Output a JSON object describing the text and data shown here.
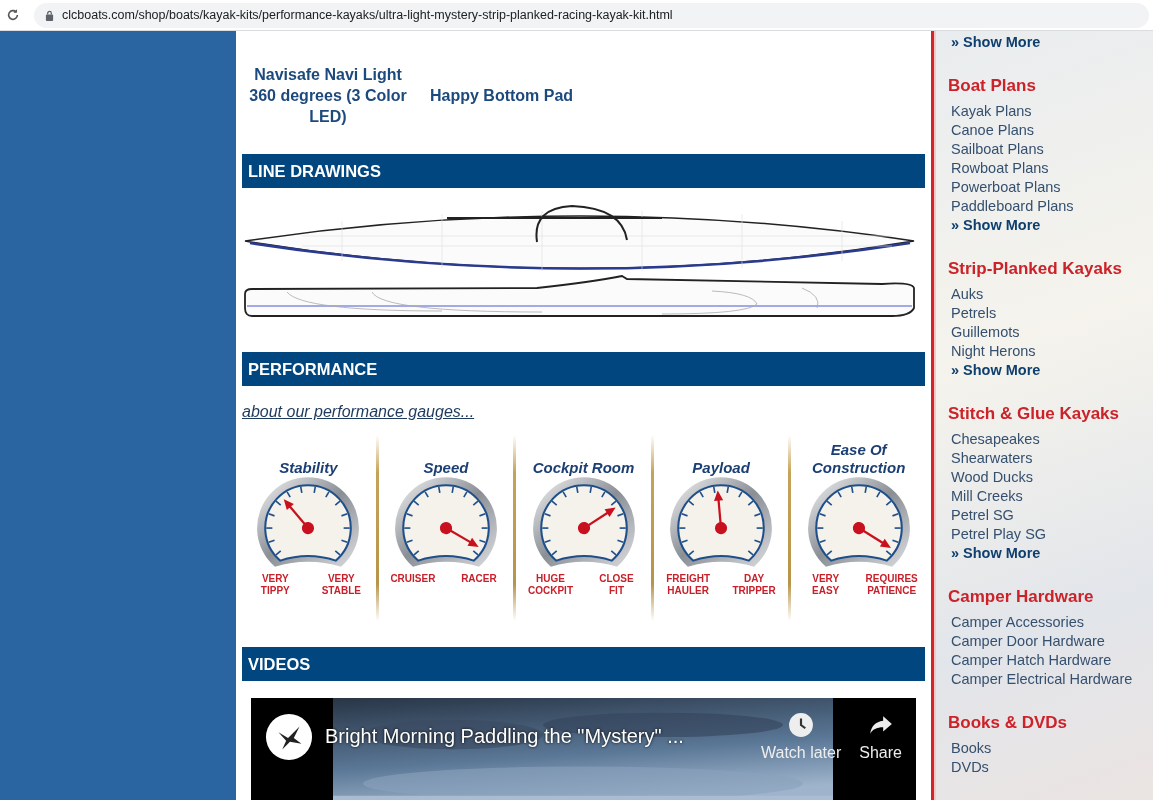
{
  "browser": {
    "url": "clcboats.com/shop/boats/kayak-kits/performance-kayaks/ultra-light-mystery-strip-planked-racing-kayak-kit.html"
  },
  "related_products": [
    {
      "name": "Navisafe Navi Light 360 degrees (3 Color LED)"
    },
    {
      "name": "Happy Bottom Pad"
    }
  ],
  "line_drawings": {
    "heading": "LINE DRAWINGS"
  },
  "performance": {
    "heading": "PERFORMANCE",
    "link": "about our performance gauges...",
    "gauges": [
      {
        "title": "Stability",
        "left_label": "VERY TIPPY",
        "right_label": "VERY STABLE"
      },
      {
        "title": "Speed",
        "left_label": "CRUISER",
        "right_label": "RACER"
      },
      {
        "title": "Cockpit Room",
        "left_label": "HUGE COCKPIT",
        "right_label": "CLOSE FIT"
      },
      {
        "title": "Payload",
        "left_label": "FREIGHT HAULER",
        "right_label": "DAY TRIPPER"
      },
      {
        "title": "Ease Of Construction",
        "left_label": "VERY EASY",
        "right_label": "REQUIRES PATIENCE"
      }
    ]
  },
  "videos": {
    "heading": "VIDEOS",
    "video": {
      "title": "Bright Morning Paddling the \"Mystery\" ...",
      "actions": [
        {
          "label": "Watch later",
          "kind": "watch-later"
        },
        {
          "label": "Share",
          "kind": "share"
        }
      ]
    }
  },
  "sidebar": {
    "top_link": "» Show More",
    "sections": [
      {
        "heading": "Boat Plans",
        "items": [
          "Kayak Plans",
          "Canoe Plans",
          "Sailboat Plans",
          "Rowboat Plans",
          "Powerboat Plans",
          "Paddleboard Plans"
        ],
        "show_more": "» Show More"
      },
      {
        "heading": "Strip-Planked Kayaks",
        "items": [
          "Auks",
          "Petrels",
          "Guillemots",
          "Night Herons"
        ],
        "show_more": "» Show More"
      },
      {
        "heading": "Stitch & Glue Kayaks",
        "items": [
          "Chesapeakes",
          "Shearwaters",
          "Wood Ducks",
          "Mill Creeks",
          "Petrel SG",
          "Petrel Play SG"
        ],
        "show_more": "» Show More"
      },
      {
        "heading": "Camper Hardware",
        "items": [
          "Camper Accessories",
          "Camper Door Hardware",
          "Camper Hatch Hardware",
          "Camper Electrical Hardware"
        ]
      },
      {
        "heading": "Books & DVDs",
        "items": [
          "Books",
          "DVDs"
        ]
      }
    ]
  }
}
